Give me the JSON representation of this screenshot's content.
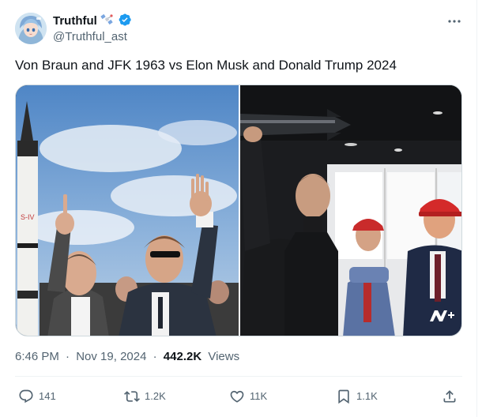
{
  "author": {
    "display_name": "Truthful",
    "handle": "@Truthful_ast",
    "verified": true,
    "emoji": "satellite-emoji",
    "avatar": "anime-avatar"
  },
  "tweet": {
    "text": "Von Braun and JFK 1963 vs Elon Musk and Donald Trump 2024",
    "time": "6:46 PM",
    "separator": "·",
    "date": "Nov 19, 2024",
    "views_count": "442.2K",
    "views_label": "Views"
  },
  "media": {
    "left_photo": "von-braun-jfk-photo",
    "right_photo": "musk-trump-photo",
    "badge": "n+-watermark"
  },
  "actions": {
    "replies": "141",
    "reposts": "1.2K",
    "likes": "11K",
    "bookmarks": "1.1K"
  },
  "colors": {
    "text": "#0f1419",
    "muted": "#536471",
    "verified": "#1d9bf0",
    "divider": "#eff3f4"
  }
}
